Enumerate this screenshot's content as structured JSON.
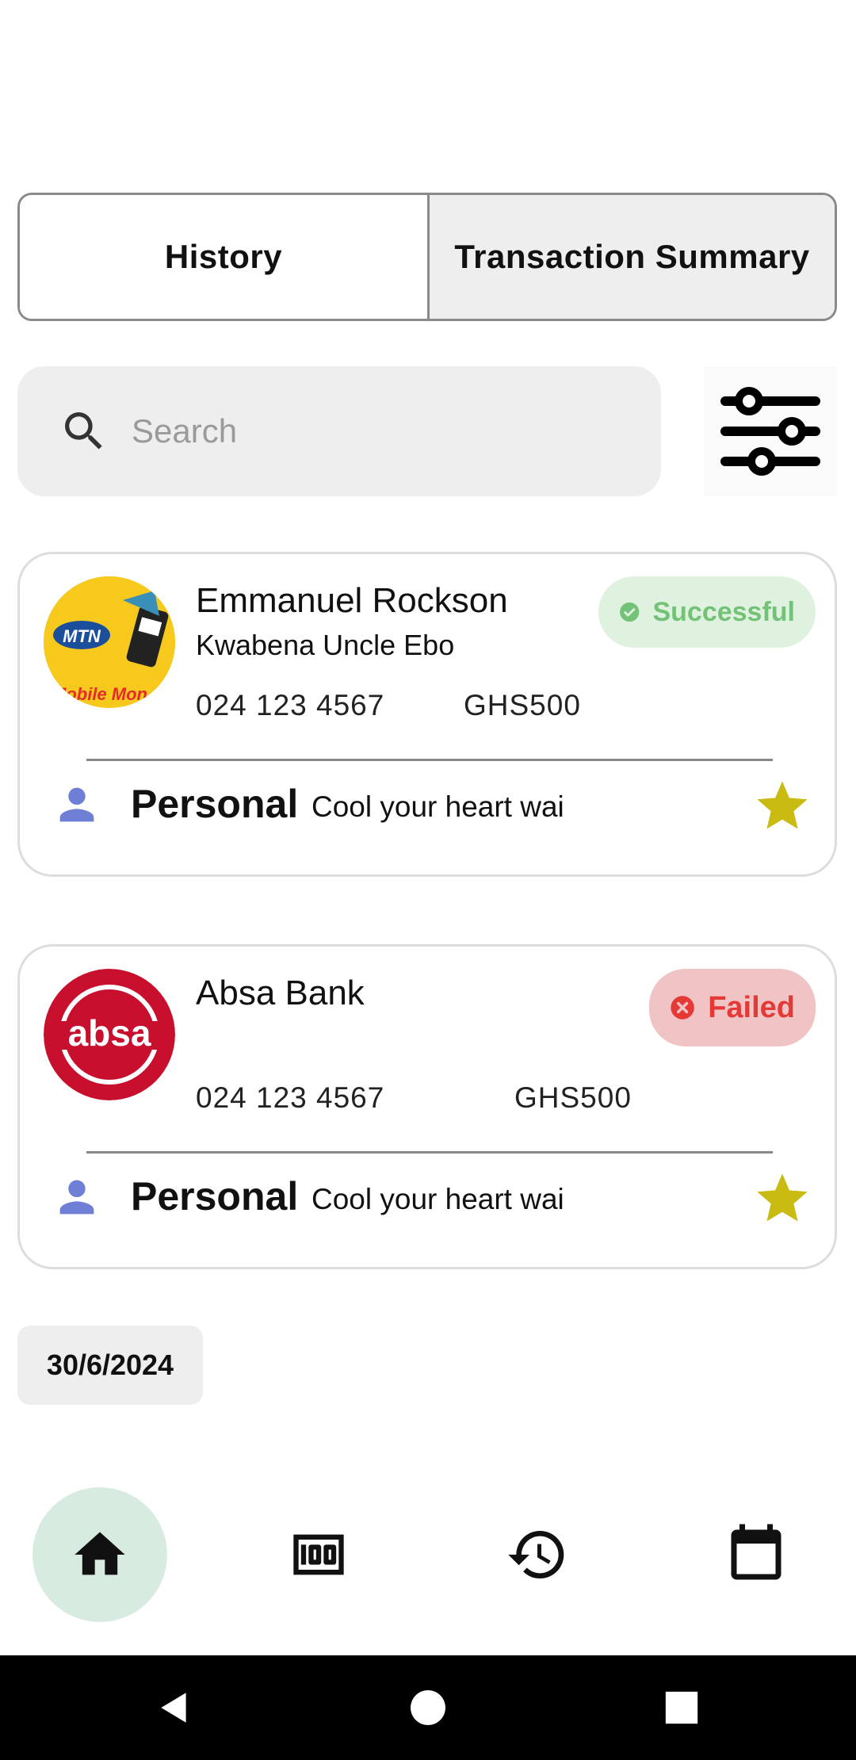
{
  "tabs": [
    {
      "label": "History"
    },
    {
      "label": "Transaction Summary"
    }
  ],
  "search": {
    "placeholder": "Search",
    "value": ""
  },
  "transactions": [
    {
      "name": "Emmanuel Rockson",
      "sub_name": "Kwabena Uncle Ebo",
      "phone": "024 123 4567",
      "amount": "GHS500",
      "status": "Successful",
      "category": "Personal",
      "note": "Cool your heart wai",
      "logo_text": "MTN",
      "logo_sub": "Mobile Mon"
    },
    {
      "name": "Absa Bank",
      "sub_name": "",
      "phone": "024 123 4567",
      "amount": "GHS500",
      "status": "Failed",
      "category": "Personal",
      "note": "Cool your heart wai",
      "logo_text": "absa"
    }
  ],
  "date_chip": "30/6/2024",
  "nav": [
    {
      "icon": "home-icon",
      "active": true
    },
    {
      "icon": "money-icon"
    },
    {
      "icon": "history-icon"
    },
    {
      "icon": "calendar-icon"
    }
  ],
  "colors": {
    "success_bg": "#dff1df",
    "success_fg": "#74c277",
    "failed_bg": "#f0c4c4",
    "failed_fg": "#e53935",
    "person_icon": "#6f7fd6",
    "star": "#c9bb12",
    "nav_active": "#d7ebe1"
  }
}
